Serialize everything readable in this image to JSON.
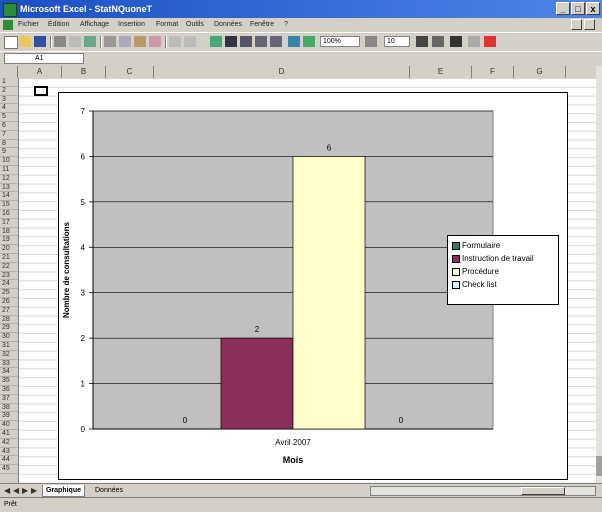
{
  "window": {
    "title": "Microsoft Excel - StatNQuoneT",
    "minimize": "_",
    "maximize": "□",
    "close": "x"
  },
  "menu": [
    "Fichier",
    "Édition",
    "Affichage",
    "Insertion",
    "Format",
    "Outils",
    "Données",
    "Fenêtre",
    "?"
  ],
  "toolbar": {
    "zoom": "100%",
    "font_size": "10"
  },
  "formula_bar": {
    "cell_ref": "A1"
  },
  "columns": [
    "A",
    "B",
    "C",
    "D",
    "E",
    "F",
    "G"
  ],
  "rows": [
    "1",
    "2",
    "3",
    "4",
    "5",
    "6",
    "7",
    "8",
    "9",
    "10",
    "11",
    "12",
    "13",
    "14",
    "15",
    "16",
    "17",
    "18",
    "19",
    "20",
    "21",
    "22",
    "23",
    "24",
    "25",
    "26",
    "27",
    "28",
    "29",
    "30",
    "31",
    "32",
    "33",
    "34",
    "35",
    "36",
    "37",
    "38",
    "39",
    "40",
    "41",
    "42",
    "43",
    "44",
    "45"
  ],
  "chart_data": {
    "type": "bar",
    "categories": [
      "Avril 2007"
    ],
    "series": [
      {
        "name": "Formulaire",
        "values": [
          0
        ],
        "color": "#2f7d5c"
      },
      {
        "name": "Instruction de travail",
        "values": [
          2
        ],
        "color": "#8b2e5a"
      },
      {
        "name": "Procédure",
        "values": [
          6
        ],
        "color": "#ffffcc"
      },
      {
        "name": "Check list",
        "values": [
          0
        ],
        "color": "#ccffff"
      }
    ],
    "data_labels": [
      "0",
      "2",
      "6",
      "0"
    ],
    "xlabel": "Mois",
    "ylabel": "Nombre de consultations",
    "ylim": [
      0,
      7
    ],
    "yticks": [
      "0",
      "1",
      "2",
      "3",
      "4",
      "5",
      "6",
      "7"
    ],
    "plot_background": "#c0c0c0",
    "grid": true,
    "legend_position": "right"
  },
  "sheets": {
    "active": "Graphique",
    "other": "Données"
  },
  "status": "Prêt"
}
